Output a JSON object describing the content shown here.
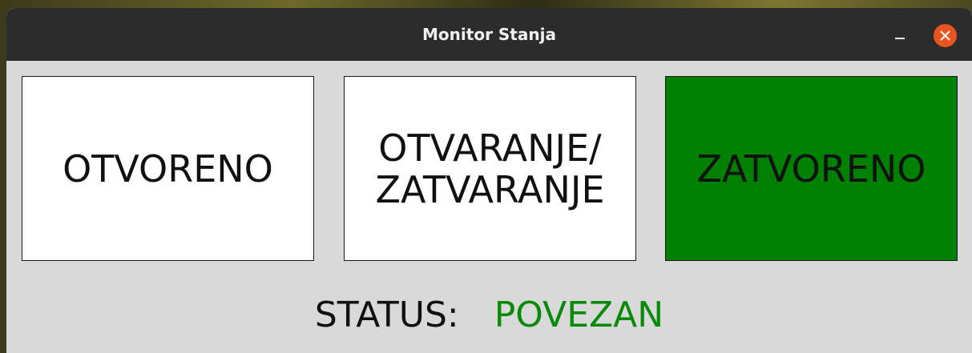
{
  "window": {
    "title": "Monitor Stanja"
  },
  "states": {
    "open": {
      "label": "OTVORENO",
      "active": false
    },
    "moving": {
      "label": "OTVARANJE/\nZATVARANJE",
      "active": false
    },
    "closed": {
      "label": "ZATVORENO",
      "active": true
    }
  },
  "status": {
    "label": "STATUS:",
    "value": "POVEZAN"
  },
  "colors": {
    "active": "#008000",
    "inactive": "#ffffff",
    "status_value": "#0a8a0a",
    "close_button": "#e9541f"
  }
}
